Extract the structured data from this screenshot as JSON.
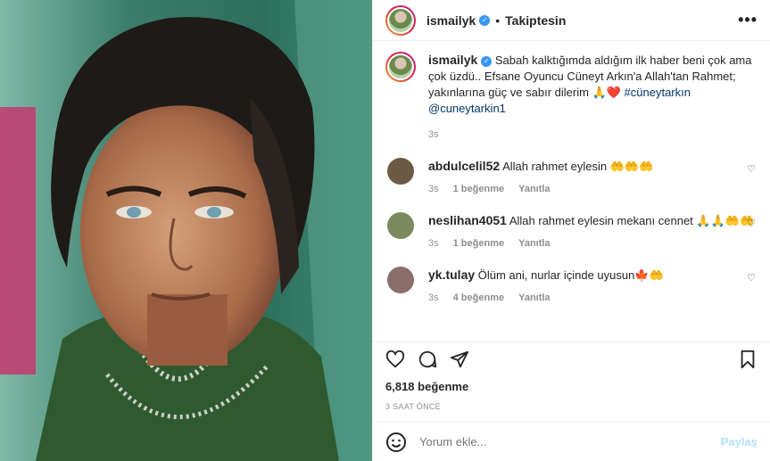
{
  "header": {
    "username": "ismailyk",
    "separator": "•",
    "follow_label": "Takiptesin",
    "more_label": "•••"
  },
  "caption": {
    "username": "ismailyk",
    "text": "Sabah kalktığımda aldığım ilk haber beni çok ama çok üzdü.. Efsane Oyuncu Cüneyt Arkın'a Allah'tan Rahmet; yakınlarına güç ve sabır dilerim 🙏❤️",
    "hashtag": "#cüneytarkın",
    "mention": "@cuneytarkin1",
    "time": "3s"
  },
  "comments": [
    {
      "username": "abdulcelil52",
      "text": "Allah rahmet eylesin 🤲🤲🤲",
      "time": "3s",
      "likes": "1 beğenme",
      "reply": "Yanıtla",
      "avatar_color": "#6d5a44"
    },
    {
      "username": "neslihan4051",
      "text": "Allah rahmet eylesin mekanı cennet 🙏🙏🤲🤲",
      "time": "3s",
      "likes": "1 beğenme",
      "reply": "Yanıtla",
      "avatar_color": "#7a8a5e"
    },
    {
      "username": "yk.tulay",
      "text": "Ölüm ani, nurlar içinde uyusun🍁🤲",
      "time": "3s",
      "likes": "4 beğenme",
      "reply": "Yanıtla",
      "avatar_color": "#8a6e6a"
    }
  ],
  "stats": {
    "likes": "6,818 beğenme",
    "time_ago": "3 SAAT ÖNCE"
  },
  "add_comment": {
    "placeholder": "Yorum ekle...",
    "post_label": "Paylaş"
  },
  "icons": {
    "like": "heart-icon",
    "comment": "comment-icon",
    "share": "share-icon",
    "save": "bookmark-icon",
    "emoji": "emoji-icon"
  },
  "colors": {
    "link": "#00376b",
    "verified": "#3897f0",
    "post_disabled": "#b2dffc"
  }
}
